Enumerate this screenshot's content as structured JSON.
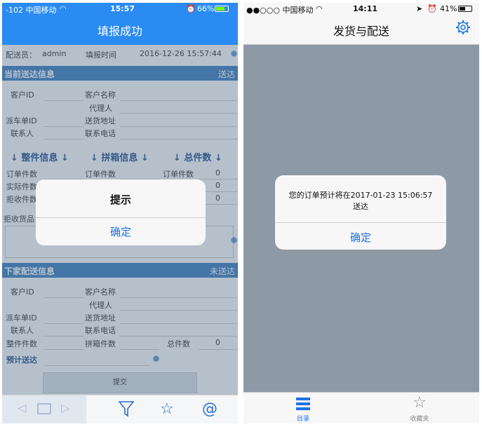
{
  "left": {
    "status": {
      "signal": "-102 中国移动",
      "time": "15:57",
      "battery": "66%"
    },
    "nav_title": "填报成功",
    "courier_label": "配送员：",
    "courier_value": "admin",
    "fill_time_label": "填报时间",
    "fill_time_value": "2016-12-26 15:57:44",
    "current": {
      "title": "当前送达信息",
      "status": "送达",
      "customer_id": "客户ID",
      "customer_name": "客户名称",
      "agent": "代理人",
      "dispatch_id": "派车单ID",
      "address": "送货地址",
      "contact": "联系人",
      "phone": "联系电话"
    },
    "groups": {
      "whole": "↓ 整件信息 ↓",
      "pack": "↓ 拼箱信息 ↓",
      "total": "↓ 总件数 ↓"
    },
    "rows": {
      "order_qty": "订单件数",
      "actual_qty": "实际件数",
      "reject_qty": "拒收件数",
      "zero": "0"
    },
    "reject_goods": "拒收货品",
    "next": {
      "title": "下家配送信息",
      "status": "未送达",
      "customer_id": "客户ID",
      "customer_name": "客户名称",
      "agent": "代理人",
      "dispatch_id": "派车单ID",
      "address": "送货地址",
      "contact": "联系人",
      "phone": "联系电话",
      "whole_qty": "整件件数",
      "pack_qty": "拼箱件数",
      "total_qty": "总件数",
      "total_value": "0",
      "eta": "预计送达"
    },
    "submit": "提交",
    "alert": {
      "title": "提示",
      "ok": "确定"
    }
  },
  "right": {
    "status": {
      "carrier": "●●○○○ 中国移动",
      "time": "14:11",
      "battery": "41%"
    },
    "nav_title": "发货与配送",
    "alert": {
      "message_line1": "您的订单预计将在2017-01-23 15:06:57",
      "message_line2": "送达",
      "ok": "确定"
    },
    "tabs": [
      {
        "label": "目录"
      },
      {
        "label": "收藏夹"
      }
    ]
  },
  "colors": {
    "accent_blue": "#2a8bf2",
    "section_blue": "#3a7ec2",
    "alert_button": "#1b72e8"
  }
}
